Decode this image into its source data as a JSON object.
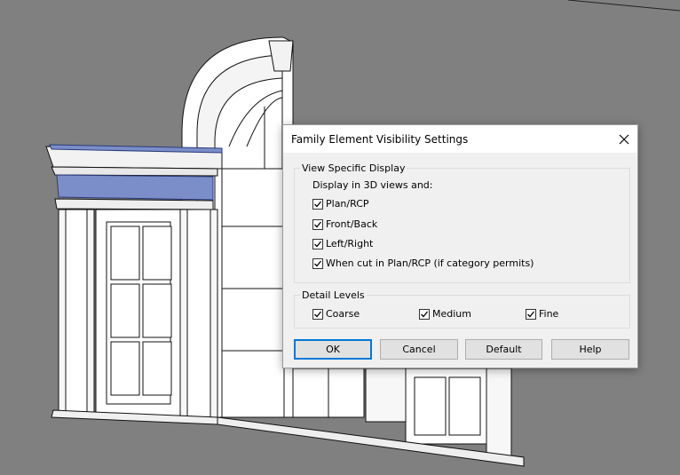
{
  "colors": {
    "viewport_bg": "#808080",
    "highlight": "#7b8ec9",
    "dialog_bg": "#f0f0f0",
    "accent": "#0078d7"
  },
  "dialog": {
    "title": "Family Element Visibility Settings",
    "close_icon": "close-icon",
    "view_specific": {
      "legend": "View Specific Display",
      "intro": "Display in 3D views and:",
      "options": [
        {
          "label": "Plan/RCP",
          "checked": true
        },
        {
          "label": "Front/Back",
          "checked": true
        },
        {
          "label": "Left/Right",
          "checked": true
        },
        {
          "label": "When cut in Plan/RCP (if category permits)",
          "checked": true
        }
      ]
    },
    "detail_levels": {
      "legend": "Detail Levels",
      "options": [
        {
          "label": "Coarse",
          "checked": true
        },
        {
          "label": "Medium",
          "checked": true
        },
        {
          "label": "Fine",
          "checked": true
        }
      ]
    },
    "buttons": {
      "ok": "OK",
      "cancel": "Cancel",
      "default": "Default",
      "help": "Help"
    }
  }
}
